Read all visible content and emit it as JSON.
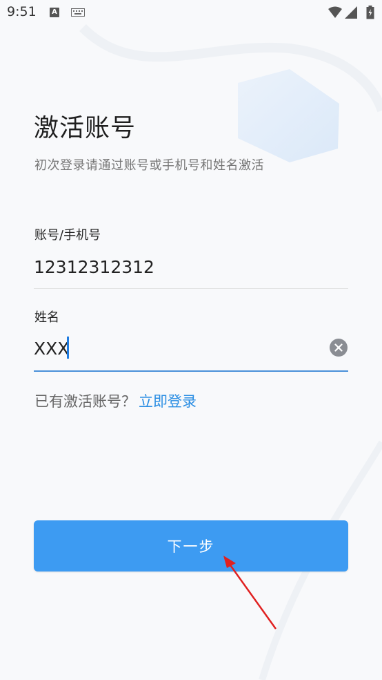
{
  "status_bar": {
    "time": "9:51",
    "icons": [
      "a-notification-icon",
      "keyboard-icon",
      "wifi-icon",
      "signal-icon",
      "battery-icon"
    ]
  },
  "page": {
    "title": "激活账号",
    "subtitle": "初次登录请通过账号或手机号和姓名激活"
  },
  "form": {
    "account_label": "账号/手机号",
    "account_value": "12312312312",
    "name_label": "姓名",
    "name_value": "XXX"
  },
  "login": {
    "hint": "已有激活账号？",
    "link": "立即登录"
  },
  "actions": {
    "next_label": "下一步"
  },
  "colors": {
    "accent": "#3d9bf2",
    "link": "#2b8ee3",
    "annotation_arrow": "#e02020"
  }
}
